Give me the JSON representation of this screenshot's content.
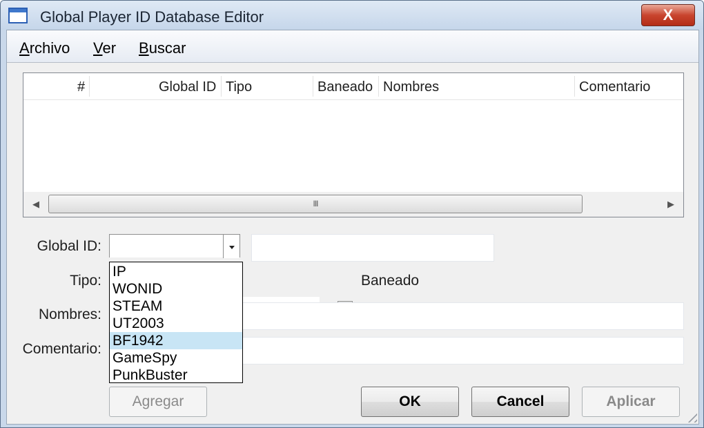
{
  "window": {
    "title": "Global Player ID Database Editor",
    "close_label": "X"
  },
  "menu": {
    "items": [
      {
        "mnemonic": "A",
        "rest": "rchivo"
      },
      {
        "mnemonic": "V",
        "rest": "er"
      },
      {
        "mnemonic": "B",
        "rest": "uscar"
      }
    ]
  },
  "list": {
    "columns": [
      "#",
      "Global ID",
      "Tipo",
      "Baneado",
      "Nombres",
      "Comentario"
    ],
    "rows": [],
    "scroll_thumb_label": "III"
  },
  "form": {
    "global_id_label": "Global ID:",
    "global_id_value": "",
    "tipo_label": "Tipo:",
    "tipo_value": "",
    "baneado_label": "Baneado",
    "baneado_checked": false,
    "nombres_label": "Nombres:",
    "nombres_value": "",
    "comentario_label": "Comentario:",
    "comentario_value": ""
  },
  "dropdown": {
    "options": [
      "IP",
      "WONID",
      "STEAM",
      "UT2003",
      "BF1942",
      "GameSpy",
      "PunkBuster"
    ],
    "highlighted": "BF1942"
  },
  "buttons": {
    "agregar": "Agregar",
    "ok": "OK",
    "cancel": "Cancel",
    "aplicar": "Aplicar"
  },
  "colors": {
    "selection": "#c8e5f5",
    "close_button": "#c9452e",
    "frame": "#c9d8ea"
  }
}
